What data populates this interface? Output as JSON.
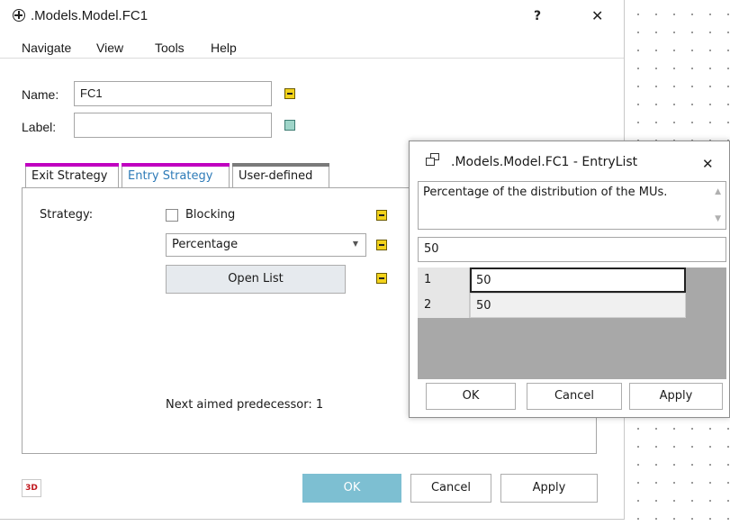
{
  "window": {
    "title": ".Models.Model.FC1",
    "help_label": "?",
    "close_label": "✕"
  },
  "menu": [
    "Navigate",
    "View",
    "Tools",
    "Help"
  ],
  "fields": {
    "name_label": "Name:",
    "name_value": "FC1",
    "label_label": "Label:",
    "label_value": ""
  },
  "tabs": [
    {
      "label": "Exit Strategy",
      "bar_color": "#c000c0"
    },
    {
      "label": "Entry Strategy",
      "bar_color": "#c000c0",
      "active": true
    },
    {
      "label": "User-defined",
      "bar_color": "#7a7a7a"
    }
  ],
  "entry_strategy": {
    "strategy_label": "Strategy:",
    "blocking_label": "Blocking",
    "blocking_checked": false,
    "mode_value": "Percentage",
    "open_list_label": "Open List",
    "next_predecessor_text": "Next aimed predecessor: 1"
  },
  "bottom": {
    "btn_3d_label": "3D",
    "ok_label": "OK",
    "cancel_label": "Cancel",
    "apply_label": "Apply"
  },
  "entry_list": {
    "title": ".Models.Model.FC1 - EntryList",
    "close_label": "✕",
    "description": "Percentage of the distribution of the MUs.",
    "current_value": "50",
    "rows": [
      {
        "index": "1",
        "value": "50"
      },
      {
        "index": "2",
        "value": "50"
      }
    ],
    "ok_label": "OK",
    "cancel_label": "Cancel",
    "apply_label": "Apply"
  },
  "colors": {
    "accent_tab_bar": "#c000c0",
    "ok_button_bg": "#7dbfd2",
    "indicator_yellow": "#f2d21b",
    "indicator_teal": "#9fd5c9",
    "grid_background": "#a8a8a8",
    "active_tab_text": "#2e7bb8"
  }
}
